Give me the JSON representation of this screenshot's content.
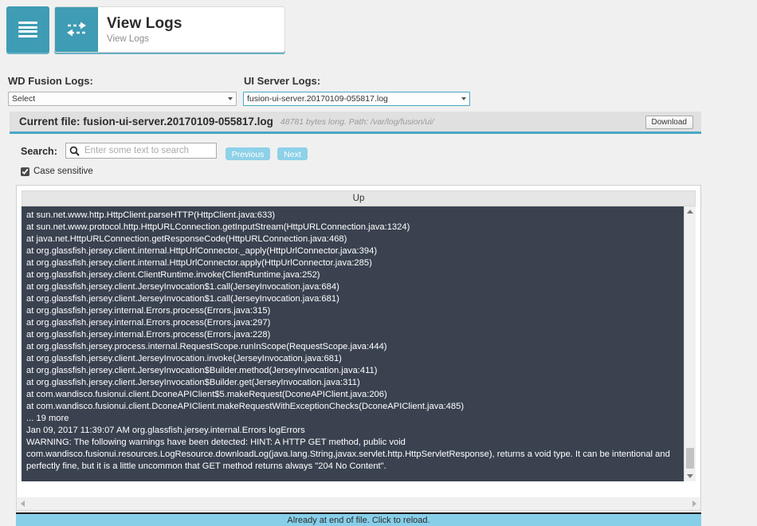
{
  "header": {
    "menu_icon": "hamburger-menu-icon",
    "title_icon": "exchange-arrows-icon",
    "title": "View Logs",
    "subtitle": "View Logs"
  },
  "filters": {
    "wd_fusion_label": "WD Fusion Logs:",
    "wd_fusion_value": "Select",
    "ui_server_label": "UI Server Logs:",
    "ui_server_value": "fusion-ui-server.20170109-055817.log"
  },
  "current_file": {
    "prefix": "Current file: fusion-ui-server.20170109-055817.log",
    "meta": "48781 bytes long. Path: /var/log/fusion/ui/",
    "download_label": "Download"
  },
  "search": {
    "label": "Search:",
    "placeholder": "Enter some text to search",
    "value": "",
    "icon": "magnifier-icon",
    "previous_label": "Previous",
    "next_label": "Next",
    "case_sensitive_label": "Case sensitive",
    "case_sensitive_checked": true
  },
  "log_viewer": {
    "up_label": "Up",
    "lines": [
      "at sun.net.www.http.HttpClient.parseHTTP(HttpClient.java:633)",
      "at sun.net.www.protocol.http.HttpURLConnection.getInputStream(HttpURLConnection.java:1324)",
      "at java.net.HttpURLConnection.getResponseCode(HttpURLConnection.java:468)",
      "at org.glassfish.jersey.client.internal.HttpUrlConnector._apply(HttpUrlConnector.java:394)",
      "at org.glassfish.jersey.client.internal.HttpUrlConnector.apply(HttpUrlConnector.java:285)",
      "at org.glassfish.jersey.client.ClientRuntime.invoke(ClientRuntime.java:252)",
      "at org.glassfish.jersey.client.JerseyInvocation$1.call(JerseyInvocation.java:684)",
      "at org.glassfish.jersey.client.JerseyInvocation$1.call(JerseyInvocation.java:681)",
      "at org.glassfish.jersey.internal.Errors.process(Errors.java:315)",
      "at org.glassfish.jersey.internal.Errors.process(Errors.java:297)",
      "at org.glassfish.jersey.internal.Errors.process(Errors.java:228)",
      "at org.glassfish.jersey.process.internal.RequestScope.runInScope(RequestScope.java:444)",
      "at org.glassfish.jersey.client.JerseyInvocation.invoke(JerseyInvocation.java:681)",
      "at org.glassfish.jersey.client.JerseyInvocation$Builder.method(JerseyInvocation.java:411)",
      "at org.glassfish.jersey.client.JerseyInvocation$Builder.get(JerseyInvocation.java:311)",
      "at com.wandisco.fusionui.client.DconeAPIClient$5.makeRequest(DconeAPIClient.java:206)",
      "at com.wandisco.fusionui.client.DconeAPIClient.makeRequestWithExceptionChecks(DconeAPIClient.java:485)",
      "... 19 more",
      "Jan 09, 2017 11:39:07 AM org.glassfish.jersey.internal.Errors logErrors",
      "WARNING: The following warnings have been detected: HINT: A HTTP GET method, public void"
    ],
    "wrapped_line": "com.wandisco.fusionui.resources.LogResource.downloadLog(java.lang.String,javax.servlet.http.HttpServletResponse), returns a void type. It can be intentional and perfectly fine, but it is a little uncommon that GET method returns always \"204 No Content\"."
  },
  "footer": {
    "status": "Already at end of file. Click to reload."
  },
  "colors": {
    "accent_teal": "#3e9cb4",
    "log_background": "#3a4250",
    "footer_blue": "#87cfe9",
    "button_blue": "#8ed1e8"
  }
}
